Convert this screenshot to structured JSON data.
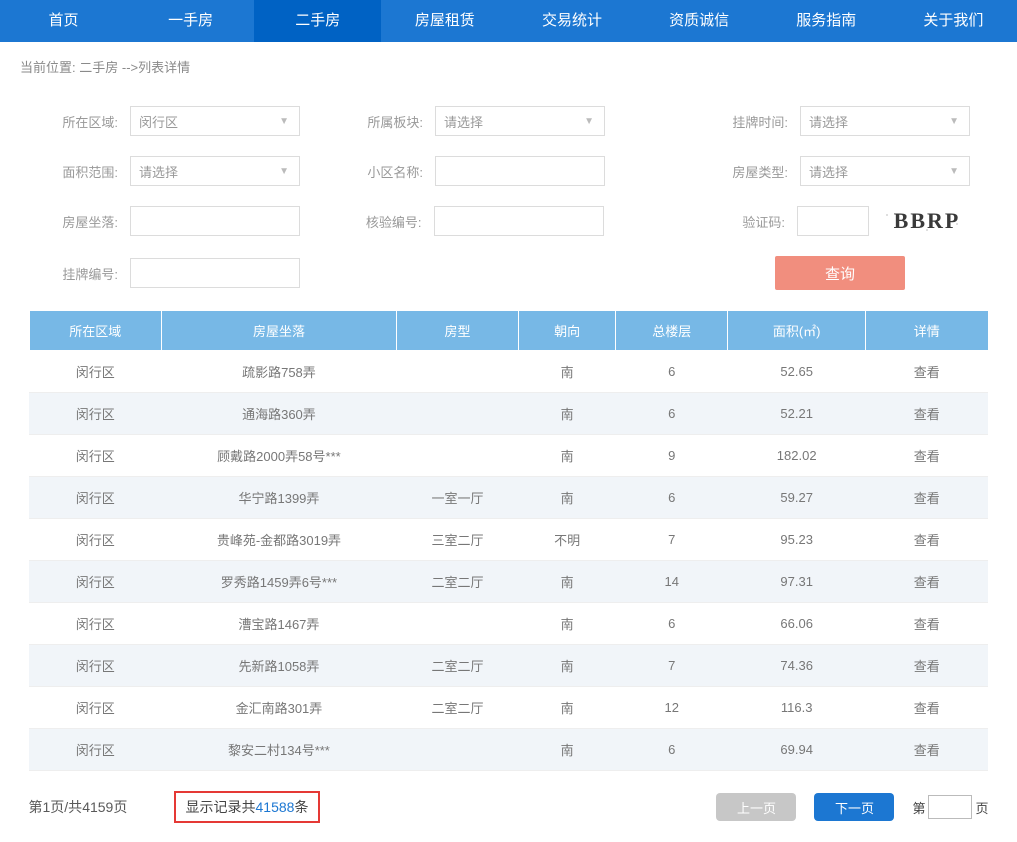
{
  "nav": {
    "items": [
      {
        "label": "首页"
      },
      {
        "label": "一手房"
      },
      {
        "label": "二手房",
        "active": true
      },
      {
        "label": "房屋租赁"
      },
      {
        "label": "交易统计"
      },
      {
        "label": "资质诚信"
      },
      {
        "label": "服务指南"
      },
      {
        "label": "关于我们"
      }
    ]
  },
  "breadcrumb": {
    "prefix": "当前位置: ",
    "link": "二手房",
    "suffix": "-->列表详情"
  },
  "filters": {
    "region_label": "所在区域:",
    "region_value": "闵行区",
    "block_label": "所属板块:",
    "block_placeholder": "请选择",
    "listtime_label": "挂牌时间:",
    "listtime_placeholder": "请选择",
    "arearange_label": "面积范围:",
    "arearange_placeholder": "请选择",
    "community_label": "小区名称:",
    "housetype_label": "房屋类型:",
    "housetype_placeholder": "请选择",
    "address_label": "房屋坐落:",
    "verifyno_label": "核验编号:",
    "captcha_label": "验证码:",
    "captcha_text": "BBRP",
    "listingno_label": "挂牌编号:",
    "search_btn": "查询"
  },
  "table": {
    "headers": {
      "region": "所在区域",
      "address": "房屋坐落",
      "type": "房型",
      "face": "朝向",
      "floor": "总楼层",
      "area": "面积(㎡)",
      "op": "详情"
    },
    "op_link": "查看",
    "rows": [
      {
        "region": "闵行区",
        "address": "疏影路758弄",
        "type": "",
        "face": "南",
        "floor": "6",
        "area": "52.65"
      },
      {
        "region": "闵行区",
        "address": "通海路360弄",
        "type": "",
        "face": "南",
        "floor": "6",
        "area": "52.21"
      },
      {
        "region": "闵行区",
        "address": "顾戴路2000弄58号***",
        "type": "",
        "face": "南",
        "floor": "9",
        "area": "182.02"
      },
      {
        "region": "闵行区",
        "address": "华宁路1399弄",
        "type": "一室一厅",
        "face": "南",
        "floor": "6",
        "area": "59.27"
      },
      {
        "region": "闵行区",
        "address": "贵峰苑-金都路3019弄",
        "type": "三室二厅",
        "face": "不明",
        "floor": "7",
        "area": "95.23"
      },
      {
        "region": "闵行区",
        "address": "罗秀路1459弄6号***",
        "type": "二室二厅",
        "face": "南",
        "floor": "14",
        "area": "97.31"
      },
      {
        "region": "闵行区",
        "address": "漕宝路1467弄",
        "type": "",
        "face": "南",
        "floor": "6",
        "area": "66.06"
      },
      {
        "region": "闵行区",
        "address": "先新路1058弄",
        "type": "二室二厅",
        "face": "南",
        "floor": "7",
        "area": "74.36"
      },
      {
        "region": "闵行区",
        "address": "金汇南路301弄",
        "type": "二室二厅",
        "face": "南",
        "floor": "12",
        "area": "116.3"
      },
      {
        "region": "闵行区",
        "address": "黎安二村134号***",
        "type": "",
        "face": "南",
        "floor": "6",
        "area": "69.94"
      }
    ]
  },
  "pager": {
    "page_info_prefix": "第",
    "current_page": "1",
    "page_info_mid": "页/共",
    "total_pages": "4159",
    "page_info_suffix": "页",
    "record_prefix": "显示记录共",
    "record_count": "41588",
    "record_suffix": "条",
    "prev": "上一页",
    "next": "下一页",
    "goto_prefix": "第",
    "goto_suffix": "页"
  }
}
